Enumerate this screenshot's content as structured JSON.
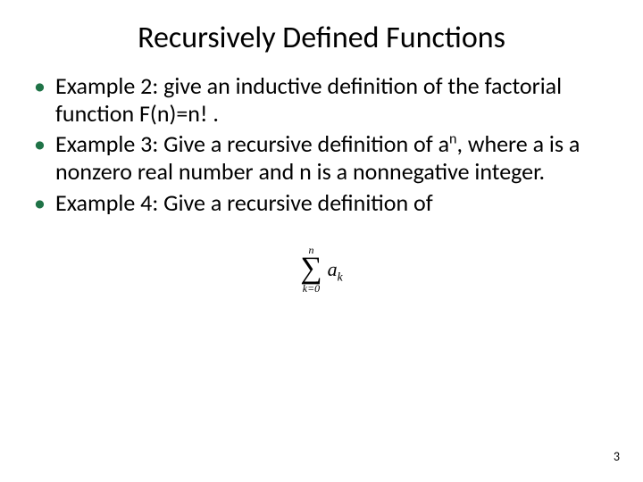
{
  "title": "Recursively Defined Functions",
  "bullets": {
    "b1_prefix": "Example 2:",
    "b1_rest": " give an inductive definition of the factorial function F(n)=n! .",
    "b2_prefix": "Example 3:",
    "b2_mid1": " Give a recursive definition of a",
    "b2_sup": "n",
    "b2_mid2": ", where a is a nonzero real number and n is a nonnegative integer.",
    "b3_prefix": "Example 4:",
    "b3_rest": " Give a recursive definition of"
  },
  "formula": {
    "upper": "n",
    "sigma": "∑",
    "lower": "k=0",
    "term_base": "a",
    "term_sub": "k"
  },
  "page_number": "3"
}
